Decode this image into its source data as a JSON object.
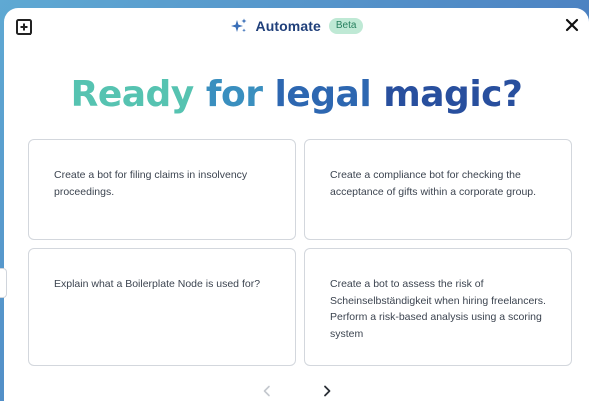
{
  "header": {
    "title": "Automate",
    "badge": "Beta",
    "icons": {
      "new_chat": "add-square-icon",
      "title": "sparkle-icon",
      "close": "close-icon"
    }
  },
  "headline": {
    "words": [
      "Ready",
      "for",
      "legal",
      "magic?"
    ]
  },
  "cards": [
    "Create a bot for filing claims in insolvency proceedings.",
    "Create a compliance bot for checking the acceptance of gifts within a corporate group.",
    "Explain what a Boilerplate Node is used for?",
    "Create a bot to assess the risk of Scheinselbständigkeit when hiring freelancers. Perform a risk-based analysis using a scoring system"
  ],
  "pager": {
    "prev_icon": "chevron-left-icon",
    "next_icon": "chevron-right-icon",
    "prev_enabled": false,
    "next_enabled": true
  },
  "colors": {
    "background": "#4e86c4",
    "title": "#1f3f7a",
    "badge_bg": "#bfe9d5",
    "badge_text": "#27805f",
    "headline_start": "#56c3b1",
    "headline_end": "#284f9e",
    "card_border": "#d3d7dd",
    "card_text": "#3c4450"
  }
}
